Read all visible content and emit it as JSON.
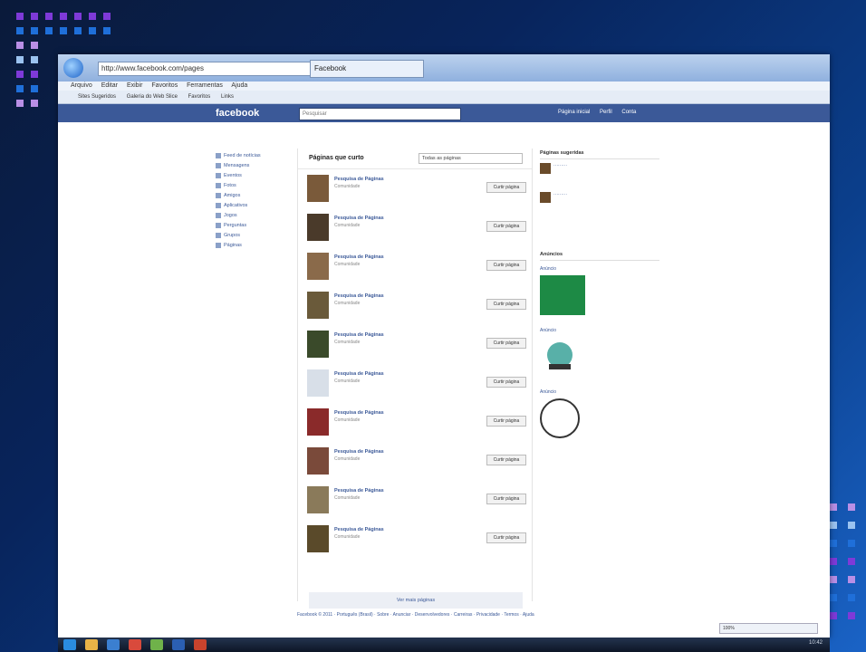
{
  "browser": {
    "address": "http://www.facebook.com/pages",
    "tab_title": "Facebook",
    "menu": [
      "Arquivo",
      "Editar",
      "Exibir",
      "Favoritos",
      "Ferramentas",
      "Ajuda"
    ],
    "favorites": [
      "Sites Sugeridos",
      "Galeria do Web Slice",
      "Favoritos",
      "Links"
    ]
  },
  "facebook": {
    "logo": "facebook",
    "search_placeholder": "Pesquisar",
    "nav": [
      "Página inicial",
      "Perfil",
      "Conta"
    ],
    "left_nav": [
      "Feed de notícias",
      "Mensagens",
      "Eventos",
      "Fotos",
      "Amigos",
      "Aplicativos",
      "Jogos",
      "Perguntas",
      "Grupos",
      "Páginas"
    ],
    "center": {
      "title": "Páginas que curto",
      "dropdown": "Todas as páginas",
      "rows": [
        {
          "name": "Pesquisa de Páginas",
          "sub": "Comunidade",
          "button": "Curtir página"
        },
        {
          "name": "Pesquisa de Páginas",
          "sub": "Comunidade",
          "button": "Curtir página"
        },
        {
          "name": "Pesquisa de Páginas",
          "sub": "Comunidade",
          "button": "Curtir página"
        },
        {
          "name": "Pesquisa de Páginas",
          "sub": "Comunidade",
          "button": "Curtir página"
        },
        {
          "name": "Pesquisa de Páginas",
          "sub": "Comunidade",
          "button": "Curtir página"
        },
        {
          "name": "Pesquisa de Páginas",
          "sub": "Comunidade",
          "button": "Curtir página"
        },
        {
          "name": "Pesquisa de Páginas",
          "sub": "Comunidade",
          "button": "Curtir página"
        },
        {
          "name": "Pesquisa de Páginas",
          "sub": "Comunidade",
          "button": "Curtir página"
        },
        {
          "name": "Pesquisa de Páginas",
          "sub": "Comunidade",
          "button": "Curtir página"
        },
        {
          "name": "Pesquisa de Páginas",
          "sub": "Comunidade",
          "button": "Curtir página"
        }
      ],
      "see_more": "Ver mais páginas"
    },
    "right": {
      "section1": "Páginas sugeridas",
      "section2": "Anúncios",
      "ad1_title": "Anúncio",
      "ad2_title": "Anúncio",
      "ad3_title": "Anúncio"
    },
    "footer": "Facebook © 2011 · Português (Brasil) · Sobre · Anunciar · Desenvolvedores · Carreiras · Privacidade · Termos · Ajuda"
  },
  "status": {
    "zoom": "100%"
  },
  "taskbar": {
    "clock": "10:42"
  }
}
